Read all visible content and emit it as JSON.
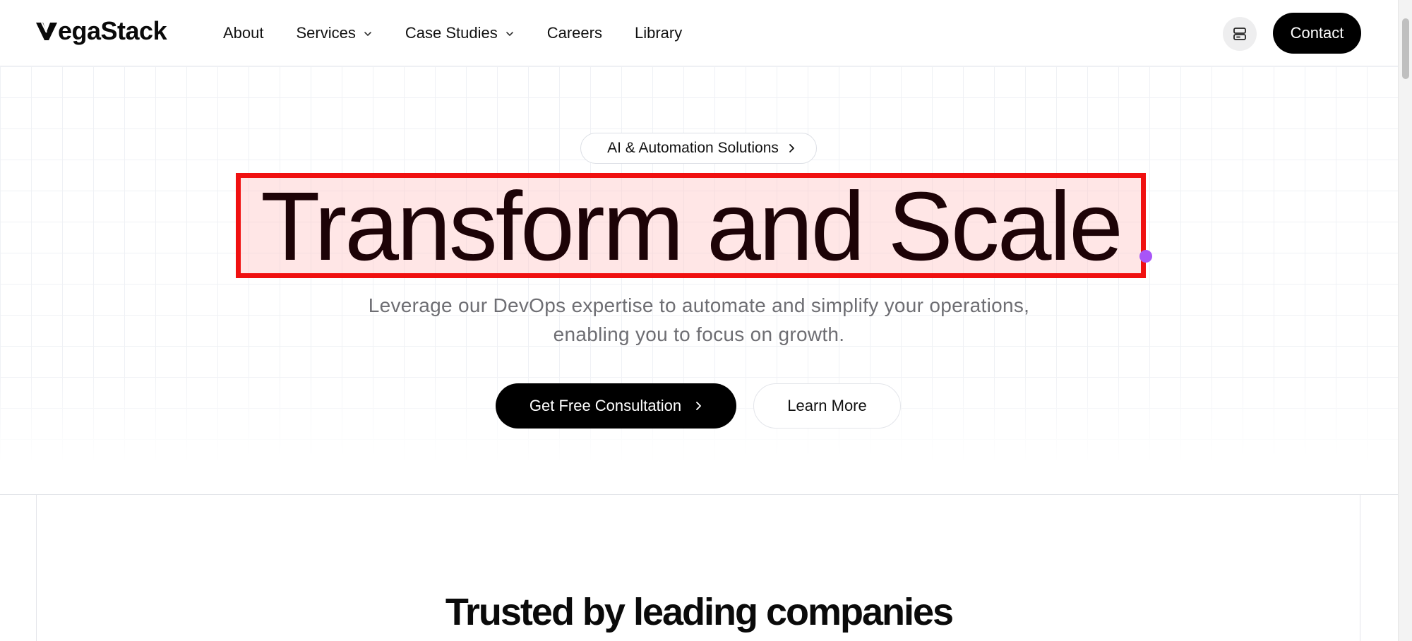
{
  "header": {
    "logo_text": "VegaStack",
    "nav": [
      {
        "label": "About",
        "has_dropdown": false
      },
      {
        "label": "Services",
        "has_dropdown": true
      },
      {
        "label": "Case Studies",
        "has_dropdown": true
      },
      {
        "label": "Careers",
        "has_dropdown": false
      },
      {
        "label": "Library",
        "has_dropdown": false
      }
    ],
    "icon_button": "server-icon",
    "contact_label": "Contact"
  },
  "hero": {
    "pill_icon_glyph": "",
    "pill_label": "AI & Automation Solutions",
    "headline": "Transform and Scale",
    "subtitle_line1": "Leverage our DevOps expertise to automate and simplify your operations,",
    "subtitle_line2": "enabling you to focus on growth.",
    "primary_cta": "Get Free Consultation",
    "secondary_cta": "Learn More"
  },
  "trusted": {
    "title": "Trusted by leading companies"
  },
  "colors": {
    "accent_highlight": "#f01010",
    "cursor_dot": "#a855f7",
    "button_dark": "#000000",
    "subtitle_gray": "#6e6e73"
  }
}
